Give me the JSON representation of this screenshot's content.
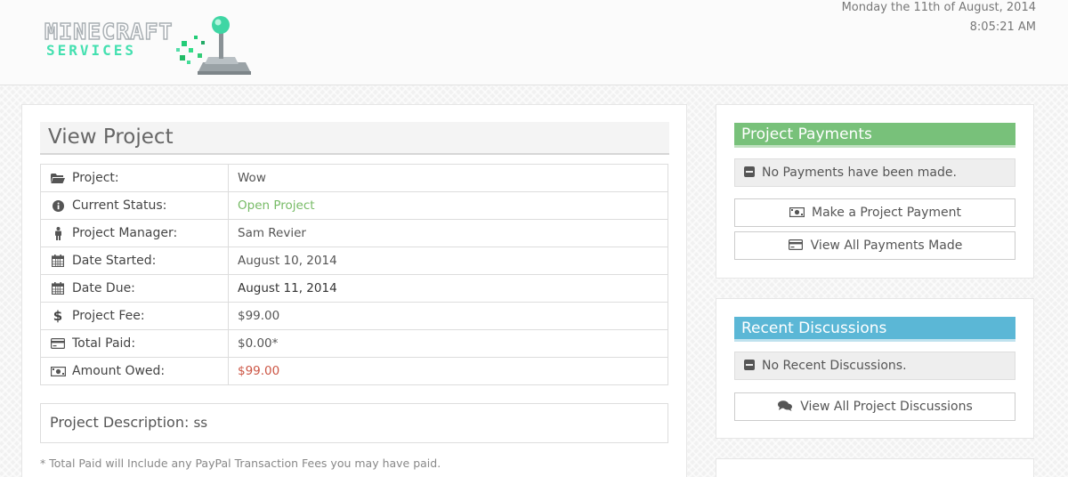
{
  "header": {
    "logo_line1": "MINECRAFT",
    "logo_line2": "SERVICES",
    "date": "Monday the 11th of August, 2014",
    "time": "8:05:21 AM"
  },
  "project": {
    "title": "View Project",
    "rows": [
      {
        "label": "Project:",
        "value": "Wow",
        "icon": "folder-open-icon"
      },
      {
        "label": "Current Status:",
        "value": "Open Project",
        "icon": "info-icon"
      },
      {
        "label": "Project Manager:",
        "value": "Sam Revier",
        "icon": "user-icon"
      },
      {
        "label": "Date Started:",
        "value": "August 10, 2014",
        "icon": "calendar-icon"
      },
      {
        "label": "Date Due:",
        "value": "August 11, 2014",
        "icon": "calendar-icon"
      },
      {
        "label": "Project Fee:",
        "value": "$99.00",
        "icon": "dollar-icon"
      },
      {
        "label": "Total Paid:",
        "value": "$0.00*",
        "icon": "credit-card-icon"
      },
      {
        "label": "Amount Owed:",
        "value": "$99.00",
        "icon": "money-icon"
      }
    ],
    "description_label": "Project Description:",
    "description_value": "ss",
    "footnote": "* Total Paid will Include any PayPal Transaction Fees you may have paid."
  },
  "payments": {
    "title": "Project Payments",
    "empty": "No Payments have been made.",
    "make_button": "Make a Project Payment",
    "view_button": "View All Payments Made"
  },
  "discussions": {
    "title": "Recent Discussions",
    "empty": "No Recent Discussions.",
    "view_button": "View All Project Discussions"
  },
  "colors": {
    "status_open": "#77bb66",
    "amount_owed": "#cc5544",
    "payments_header": "#78c17a",
    "discussions_header": "#5bb7d6"
  }
}
